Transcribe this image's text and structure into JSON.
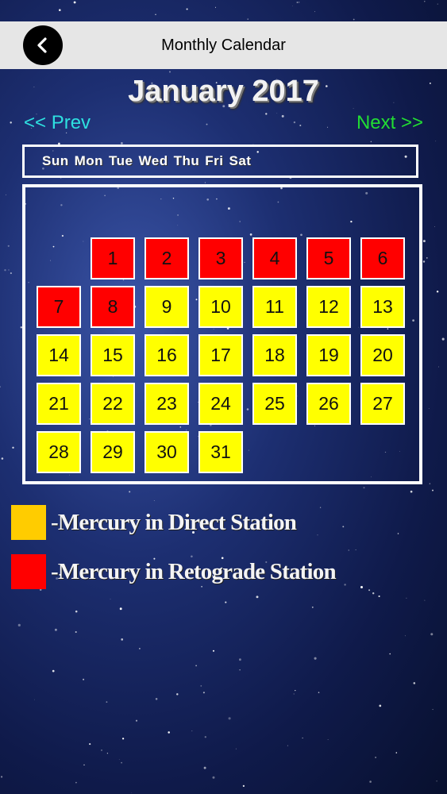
{
  "nav": {
    "title": "Monthly Calendar",
    "back_icon": "chevron-left-icon"
  },
  "calendar": {
    "month_title": "January 2017",
    "prev_label": "<< Prev",
    "next_label": "Next >>",
    "weekdays": [
      "Sun",
      "Mon",
      "Tue",
      "Wed",
      "Thu",
      "Fri",
      "Sat"
    ],
    "first_weekday": "Mon",
    "days": [
      {
        "n": "1",
        "status": "retrograde"
      },
      {
        "n": "2",
        "status": "retrograde"
      },
      {
        "n": "3",
        "status": "retrograde"
      },
      {
        "n": "4",
        "status": "retrograde"
      },
      {
        "n": "5",
        "status": "retrograde"
      },
      {
        "n": "6",
        "status": "retrograde"
      },
      {
        "n": "7",
        "status": "retrograde"
      },
      {
        "n": "8",
        "status": "retrograde"
      },
      {
        "n": "9",
        "status": "direct"
      },
      {
        "n": "10",
        "status": "direct"
      },
      {
        "n": "11",
        "status": "direct"
      },
      {
        "n": "12",
        "status": "direct"
      },
      {
        "n": "13",
        "status": "direct"
      },
      {
        "n": "14",
        "status": "direct"
      },
      {
        "n": "15",
        "status": "direct"
      },
      {
        "n": "16",
        "status": "direct"
      },
      {
        "n": "17",
        "status": "direct"
      },
      {
        "n": "18",
        "status": "direct"
      },
      {
        "n": "19",
        "status": "direct"
      },
      {
        "n": "20",
        "status": "direct"
      },
      {
        "n": "21",
        "status": "direct"
      },
      {
        "n": "22",
        "status": "direct"
      },
      {
        "n": "23",
        "status": "direct"
      },
      {
        "n": "24",
        "status": "direct"
      },
      {
        "n": "25",
        "status": "direct"
      },
      {
        "n": "26",
        "status": "direct"
      },
      {
        "n": "27",
        "status": "direct"
      },
      {
        "n": "28",
        "status": "direct"
      },
      {
        "n": "29",
        "status": "direct"
      },
      {
        "n": "30",
        "status": "direct"
      },
      {
        "n": "31",
        "status": "direct"
      }
    ]
  },
  "legend": {
    "direct_label": "-Mercury in Direct Station",
    "retrograde_label": "-Mercury in Retograde Station"
  },
  "colors": {
    "direct": "#ffff00",
    "retrograde": "#ff0000",
    "direct_swatch": "#ffcc00",
    "retrograde_swatch": "#ff0000",
    "prev_link": "#2ee0e0",
    "next_link": "#22dd33"
  }
}
